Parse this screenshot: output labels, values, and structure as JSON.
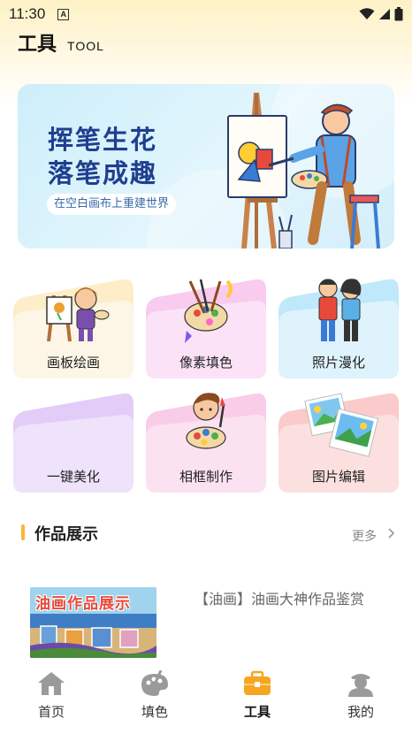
{
  "status_bar": {
    "time": "11:30",
    "notification_badge": "A",
    "icons": [
      "wifi-icon",
      "signal-icon",
      "battery-icon"
    ]
  },
  "header": {
    "title": "工具",
    "subtitle": "TOOL"
  },
  "banner": {
    "line1": "挥笔生花",
    "line2": "落笔成趣",
    "tagline": "在空白画布上重建世界"
  },
  "tools": [
    {
      "label": "画板绘画",
      "icon": "girl-easel-icon",
      "color": "#fde7b8"
    },
    {
      "label": "像素填色",
      "icon": "paint-palette-icon",
      "color": "#f9d9f2"
    },
    {
      "label": "照片漫化",
      "icon": "cartoon-couple-icon",
      "color": "#d7f0fb"
    },
    {
      "label": "一键美化",
      "icon": "beautify-icon",
      "color": "#ecdffb"
    },
    {
      "label": "相框制作",
      "icon": "boy-painter-icon",
      "color": "#fbdff0"
    },
    {
      "label": "图片编辑",
      "icon": "photo-frames-icon",
      "color": "#fde0e0"
    }
  ],
  "works": {
    "section_title": "作品展示",
    "more_label": "更多",
    "items": [
      {
        "thumb_title": "油画作品展示",
        "description": "【油画】油画大神作品鉴赏"
      }
    ]
  },
  "tabbar": {
    "tabs": [
      {
        "label": "首页",
        "icon": "home-icon",
        "active": false
      },
      {
        "label": "填色",
        "icon": "palette-icon",
        "active": false
      },
      {
        "label": "工具",
        "icon": "toolbox-icon",
        "active": true
      },
      {
        "label": "我的",
        "icon": "profile-icon",
        "active": false
      }
    ]
  },
  "colors": {
    "accent": "#ffb33b",
    "banner_text": "#1f3f8f",
    "active_tab": "#f5a623"
  }
}
